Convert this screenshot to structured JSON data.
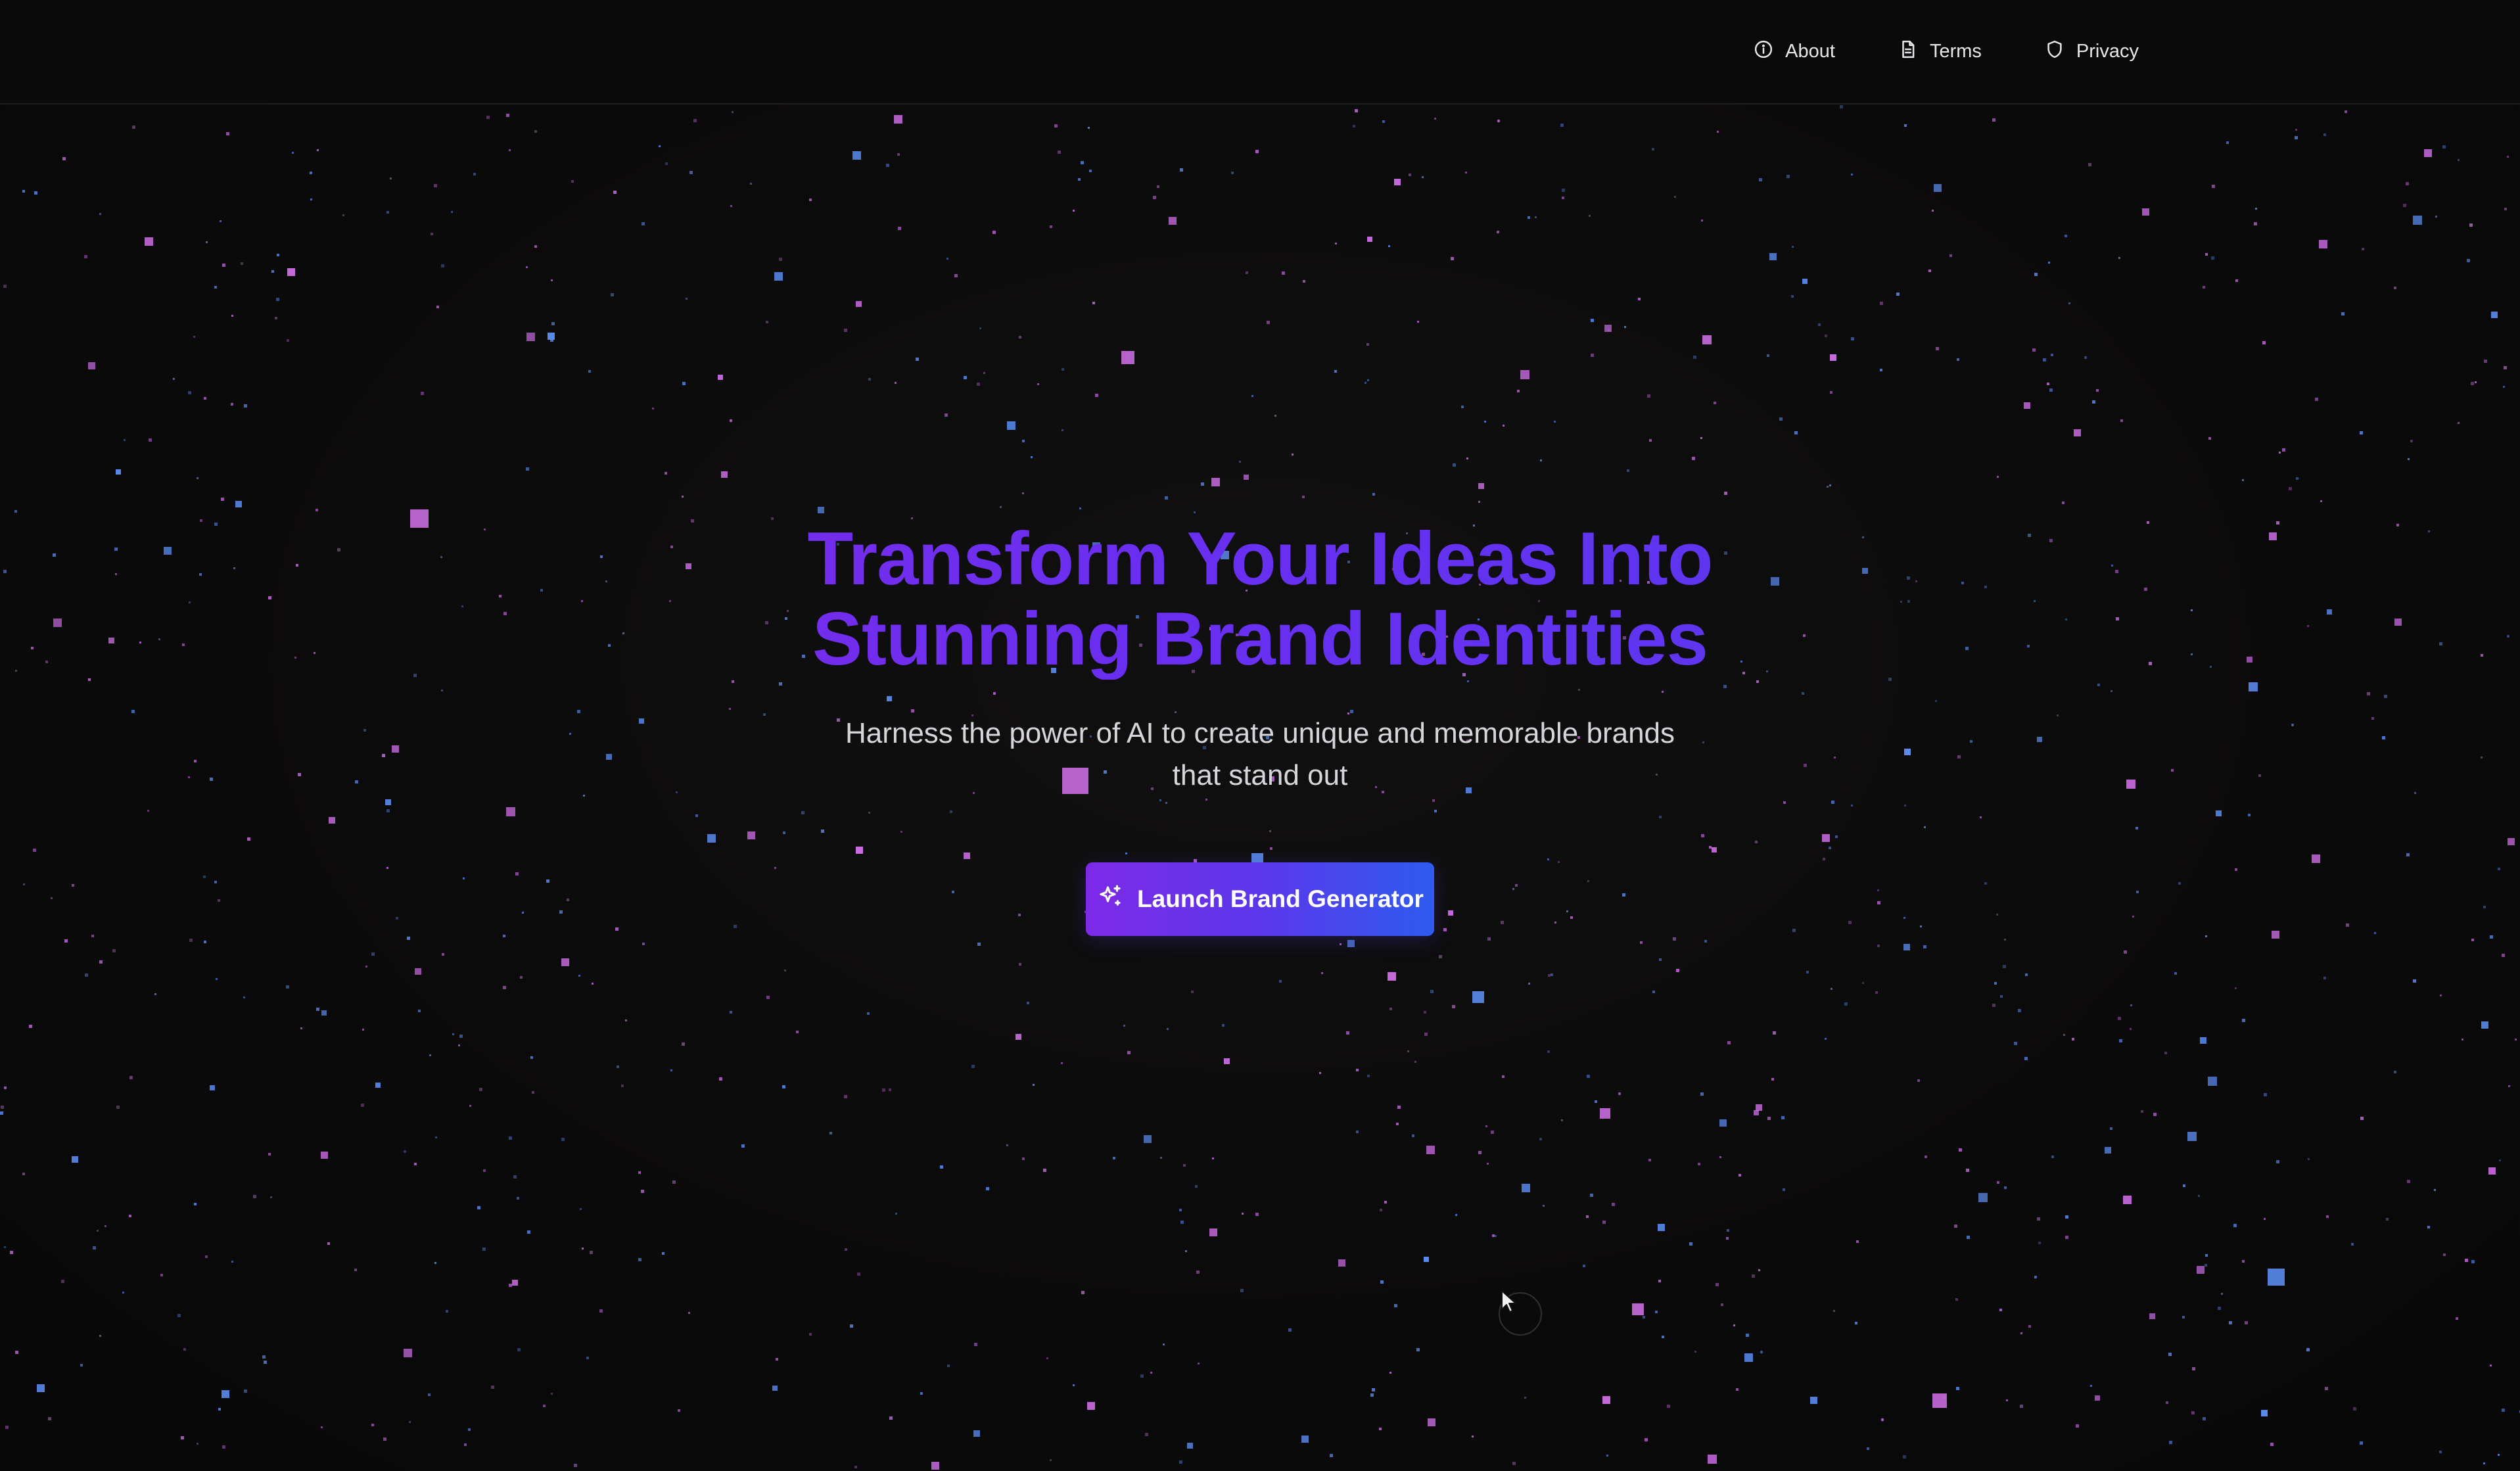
{
  "nav": {
    "items": [
      {
        "label": "About",
        "icon": "info-icon"
      },
      {
        "label": "Terms",
        "icon": "document-icon"
      },
      {
        "label": "Privacy",
        "icon": "shield-icon"
      }
    ]
  },
  "hero": {
    "title_line1": "Transform Your Ideas Into",
    "title_line2": "Stunning Brand Identities",
    "subtitle_line1": "Harness the power of AI to create unique and memorable brands",
    "subtitle_line2": "that stand out",
    "cta_label": "Launch Brand Generator",
    "cta_icon": "sparkles-icon"
  },
  "colors": {
    "background": "#0b0a0a",
    "title_gradient_start": "#8a2be2",
    "title_gradient_end": "#4f3ff0",
    "cta_gradient_start": "#7d2ae8",
    "cta_gradient_end": "#2f5bef",
    "particle_pink": "#c86be0",
    "particle_blue": "#5b8cf0"
  }
}
